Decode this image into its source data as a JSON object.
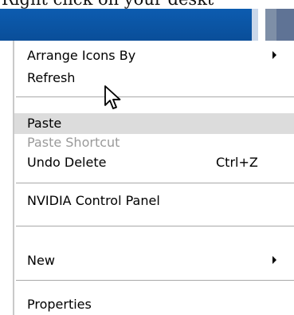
{
  "caption": "Right click on your deskt",
  "menu": {
    "items": [
      {
        "label": "Arrange Icons By",
        "submenu": true
      },
      {
        "label": "Refresh"
      },
      {
        "label": "Paste",
        "hovered": true
      },
      {
        "label": "Paste Shortcut",
        "disabled": true
      },
      {
        "label": "Undo Delete",
        "shortcut": "Ctrl+Z"
      },
      {
        "label": "NVIDIA Control Panel"
      },
      {
        "label": "New",
        "submenu": true
      },
      {
        "label": "Properties"
      }
    ]
  },
  "cursor": {
    "icon": "arrow-cursor-icon"
  }
}
